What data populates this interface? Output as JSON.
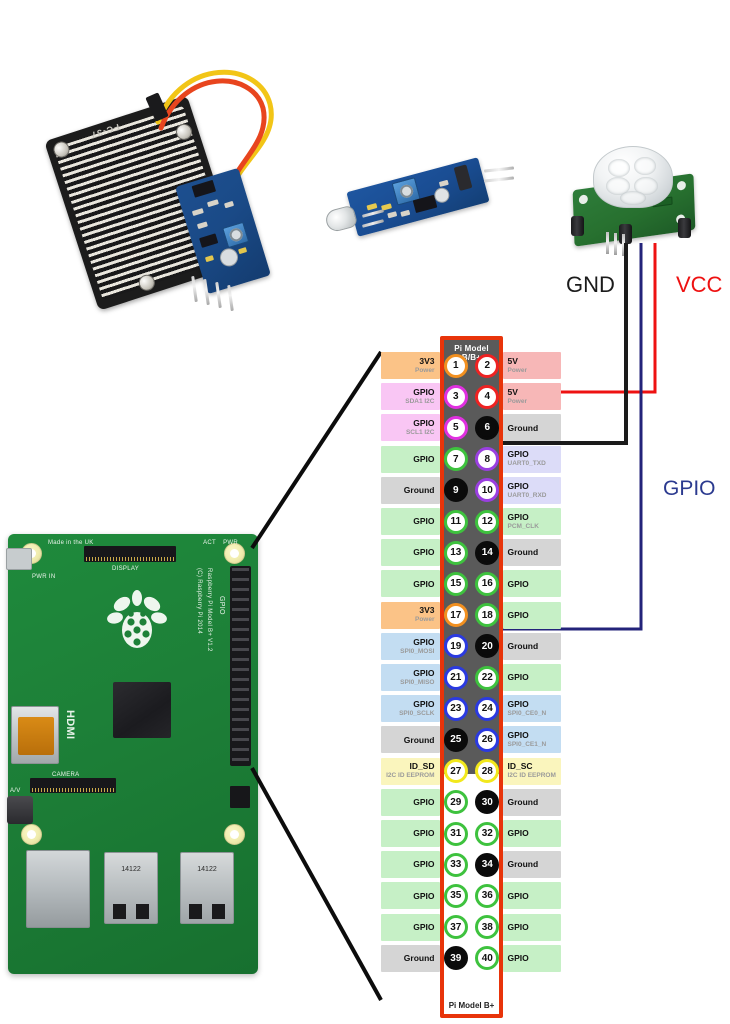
{
  "diagram": {
    "title_top": "Pi Model B/B+",
    "title_bottom": "Pi Model B+",
    "border_color": "#e8340a",
    "body_color": "#5a5a5a"
  },
  "annotations": {
    "gnd": "GND",
    "vcc": "VCC",
    "gpio": "GPIO",
    "gnd_color": "#1b1b1b",
    "vcc_color": "#ee1111",
    "gpio_color": "#2b3a8f"
  },
  "wires": [
    {
      "name": "vcc-wire",
      "color": "#ee1111",
      "from_pin": 4,
      "label": "VCC"
    },
    {
      "name": "gnd-wire",
      "color": "#1b1b1b",
      "from_pin": 6,
      "label": "GND"
    },
    {
      "name": "gpio-wire",
      "color": "#23237a",
      "from_pin": 18,
      "label": "GPIO"
    }
  ],
  "pins": [
    {
      "n": 1,
      "side": "left",
      "main": "3V3",
      "sub": "Power",
      "bg": "#fbc387",
      "ring": "#f29020"
    },
    {
      "n": 2,
      "side": "right",
      "main": "5V",
      "sub": "Power",
      "bg": "#f7b7b7",
      "ring": "#ee2222"
    },
    {
      "n": 3,
      "side": "left",
      "main": "GPIO",
      "sub": "SDA1 I2C",
      "bg": "#f9c6f4",
      "ring": "#e030e0"
    },
    {
      "n": 4,
      "side": "right",
      "main": "5V",
      "sub": "Power",
      "bg": "#f7b7b7",
      "ring": "#ee2222"
    },
    {
      "n": 5,
      "side": "left",
      "main": "GPIO",
      "sub": "SCL1 I2C",
      "bg": "#f9c6f4",
      "ring": "#e030e0"
    },
    {
      "n": 6,
      "side": "right",
      "main": "Ground",
      "sub": "",
      "bg": "#d5d5d5",
      "ring": "#0b0b0b",
      "fill": "black"
    },
    {
      "n": 7,
      "side": "left",
      "main": "GPIO",
      "sub": "",
      "bg": "#c6f0c6",
      "ring": "#3ec23e"
    },
    {
      "n": 8,
      "side": "right",
      "main": "GPIO",
      "sub": "UART0_TXD",
      "bg": "#dcdcf8",
      "ring": "#9a3fe0"
    },
    {
      "n": 9,
      "side": "left",
      "main": "Ground",
      "sub": "",
      "bg": "#d5d5d5",
      "ring": "#0b0b0b",
      "fill": "black"
    },
    {
      "n": 10,
      "side": "right",
      "main": "GPIO",
      "sub": "UART0_RXD",
      "bg": "#dcdcf8",
      "ring": "#9a3fe0"
    },
    {
      "n": 11,
      "side": "left",
      "main": "GPIO",
      "sub": "",
      "bg": "#c6f0c6",
      "ring": "#3ec23e"
    },
    {
      "n": 12,
      "side": "right",
      "main": "GPIO",
      "sub": "PCM_CLK",
      "bg": "#c6f0c6",
      "ring": "#3ec23e"
    },
    {
      "n": 13,
      "side": "left",
      "main": "GPIO",
      "sub": "",
      "bg": "#c6f0c6",
      "ring": "#3ec23e"
    },
    {
      "n": 14,
      "side": "right",
      "main": "Ground",
      "sub": "",
      "bg": "#d5d5d5",
      "ring": "#0b0b0b",
      "fill": "black"
    },
    {
      "n": 15,
      "side": "left",
      "main": "GPIO",
      "sub": "",
      "bg": "#c6f0c6",
      "ring": "#3ec23e"
    },
    {
      "n": 16,
      "side": "right",
      "main": "GPIO",
      "sub": "",
      "bg": "#c6f0c6",
      "ring": "#3ec23e"
    },
    {
      "n": 17,
      "side": "left",
      "main": "3V3",
      "sub": "Power",
      "bg": "#fbc387",
      "ring": "#f29020"
    },
    {
      "n": 18,
      "side": "right",
      "main": "GPIO",
      "sub": "",
      "bg": "#c6f0c6",
      "ring": "#3ec23e"
    },
    {
      "n": 19,
      "side": "left",
      "main": "GPIO",
      "sub": "SPI0_MOSI",
      "bg": "#c3ddf2",
      "ring": "#2b3ae0"
    },
    {
      "n": 20,
      "side": "right",
      "main": "Ground",
      "sub": "",
      "bg": "#d5d5d5",
      "ring": "#0b0b0b",
      "fill": "black"
    },
    {
      "n": 21,
      "side": "left",
      "main": "GPIO",
      "sub": "SPI0_MISO",
      "bg": "#c3ddf2",
      "ring": "#2b3ae0"
    },
    {
      "n": 22,
      "side": "right",
      "main": "GPIO",
      "sub": "",
      "bg": "#c6f0c6",
      "ring": "#3ec23e"
    },
    {
      "n": 23,
      "side": "left",
      "main": "GPIO",
      "sub": "SPI0_SCLK",
      "bg": "#c3ddf2",
      "ring": "#2b3ae0"
    },
    {
      "n": 24,
      "side": "right",
      "main": "GPIO",
      "sub": "SPI0_CE0_N",
      "bg": "#c3ddf2",
      "ring": "#2b3ae0"
    },
    {
      "n": 25,
      "side": "left",
      "main": "Ground",
      "sub": "",
      "bg": "#d5d5d5",
      "ring": "#0b0b0b",
      "fill": "black"
    },
    {
      "n": 26,
      "side": "right",
      "main": "GPIO",
      "sub": "SPI0_CE1_N",
      "bg": "#c3ddf2",
      "ring": "#2b3ae0"
    },
    {
      "n": 27,
      "side": "left",
      "main": "ID_SD",
      "sub": "I2C ID EEPROM",
      "bg": "#faf5bd",
      "ring": "#f2e81c"
    },
    {
      "n": 28,
      "side": "right",
      "main": "ID_SC",
      "sub": "I2C ID EEPROM",
      "bg": "#faf5bd",
      "ring": "#f2e81c"
    },
    {
      "n": 29,
      "side": "left",
      "main": "GPIO",
      "sub": "",
      "bg": "#c6f0c6",
      "ring": "#3ec23e"
    },
    {
      "n": 30,
      "side": "right",
      "main": "Ground",
      "sub": "",
      "bg": "#d5d5d5",
      "ring": "#0b0b0b",
      "fill": "black"
    },
    {
      "n": 31,
      "side": "left",
      "main": "GPIO",
      "sub": "",
      "bg": "#c6f0c6",
      "ring": "#3ec23e"
    },
    {
      "n": 32,
      "side": "right",
      "main": "GPIO",
      "sub": "",
      "bg": "#c6f0c6",
      "ring": "#3ec23e"
    },
    {
      "n": 33,
      "side": "left",
      "main": "GPIO",
      "sub": "",
      "bg": "#c6f0c6",
      "ring": "#3ec23e"
    },
    {
      "n": 34,
      "side": "right",
      "main": "Ground",
      "sub": "",
      "bg": "#d5d5d5",
      "ring": "#0b0b0b",
      "fill": "black"
    },
    {
      "n": 35,
      "side": "left",
      "main": "GPIO",
      "sub": "",
      "bg": "#c6f0c6",
      "ring": "#3ec23e"
    },
    {
      "n": 36,
      "side": "right",
      "main": "GPIO",
      "sub": "",
      "bg": "#c6f0c6",
      "ring": "#3ec23e"
    },
    {
      "n": 37,
      "side": "left",
      "main": "GPIO",
      "sub": "",
      "bg": "#c6f0c6",
      "ring": "#3ec23e"
    },
    {
      "n": 38,
      "side": "right",
      "main": "GPIO",
      "sub": "",
      "bg": "#c6f0c6",
      "ring": "#3ec23e"
    },
    {
      "n": 39,
      "side": "left",
      "main": "Ground",
      "sub": "",
      "bg": "#d5d5d5",
      "ring": "#0b0b0b",
      "fill": "black"
    },
    {
      "n": 40,
      "side": "right",
      "main": "GPIO",
      "sub": "",
      "bg": "#c6f0c6",
      "ring": "#3ec23e"
    }
  ],
  "photos": {
    "rain_sensor": {
      "name": "rain-sensor-module",
      "board_text": "FC-37"
    },
    "ir_sensor": {
      "name": "infrared-flame-sensor-module"
    },
    "pir_sensor": {
      "name": "pir-motion-sensor-module"
    },
    "raspberry_pi": {
      "name": "raspberry-pi-model-b-plus",
      "silk": {
        "made_in": "Made in the UK",
        "display": "DISPLAY",
        "camera": "CAMERA",
        "model": "Raspberry Pi Model B+ V1.2",
        "copyright": "(C) Raspberry Pi 2014",
        "pwr_in": "PWR IN",
        "hdmi": "HDMI",
        "gpio": "GPIO",
        "av": "A/V",
        "act": "ACT",
        "pwr": "PWR",
        "usb_code": "14122"
      }
    }
  }
}
